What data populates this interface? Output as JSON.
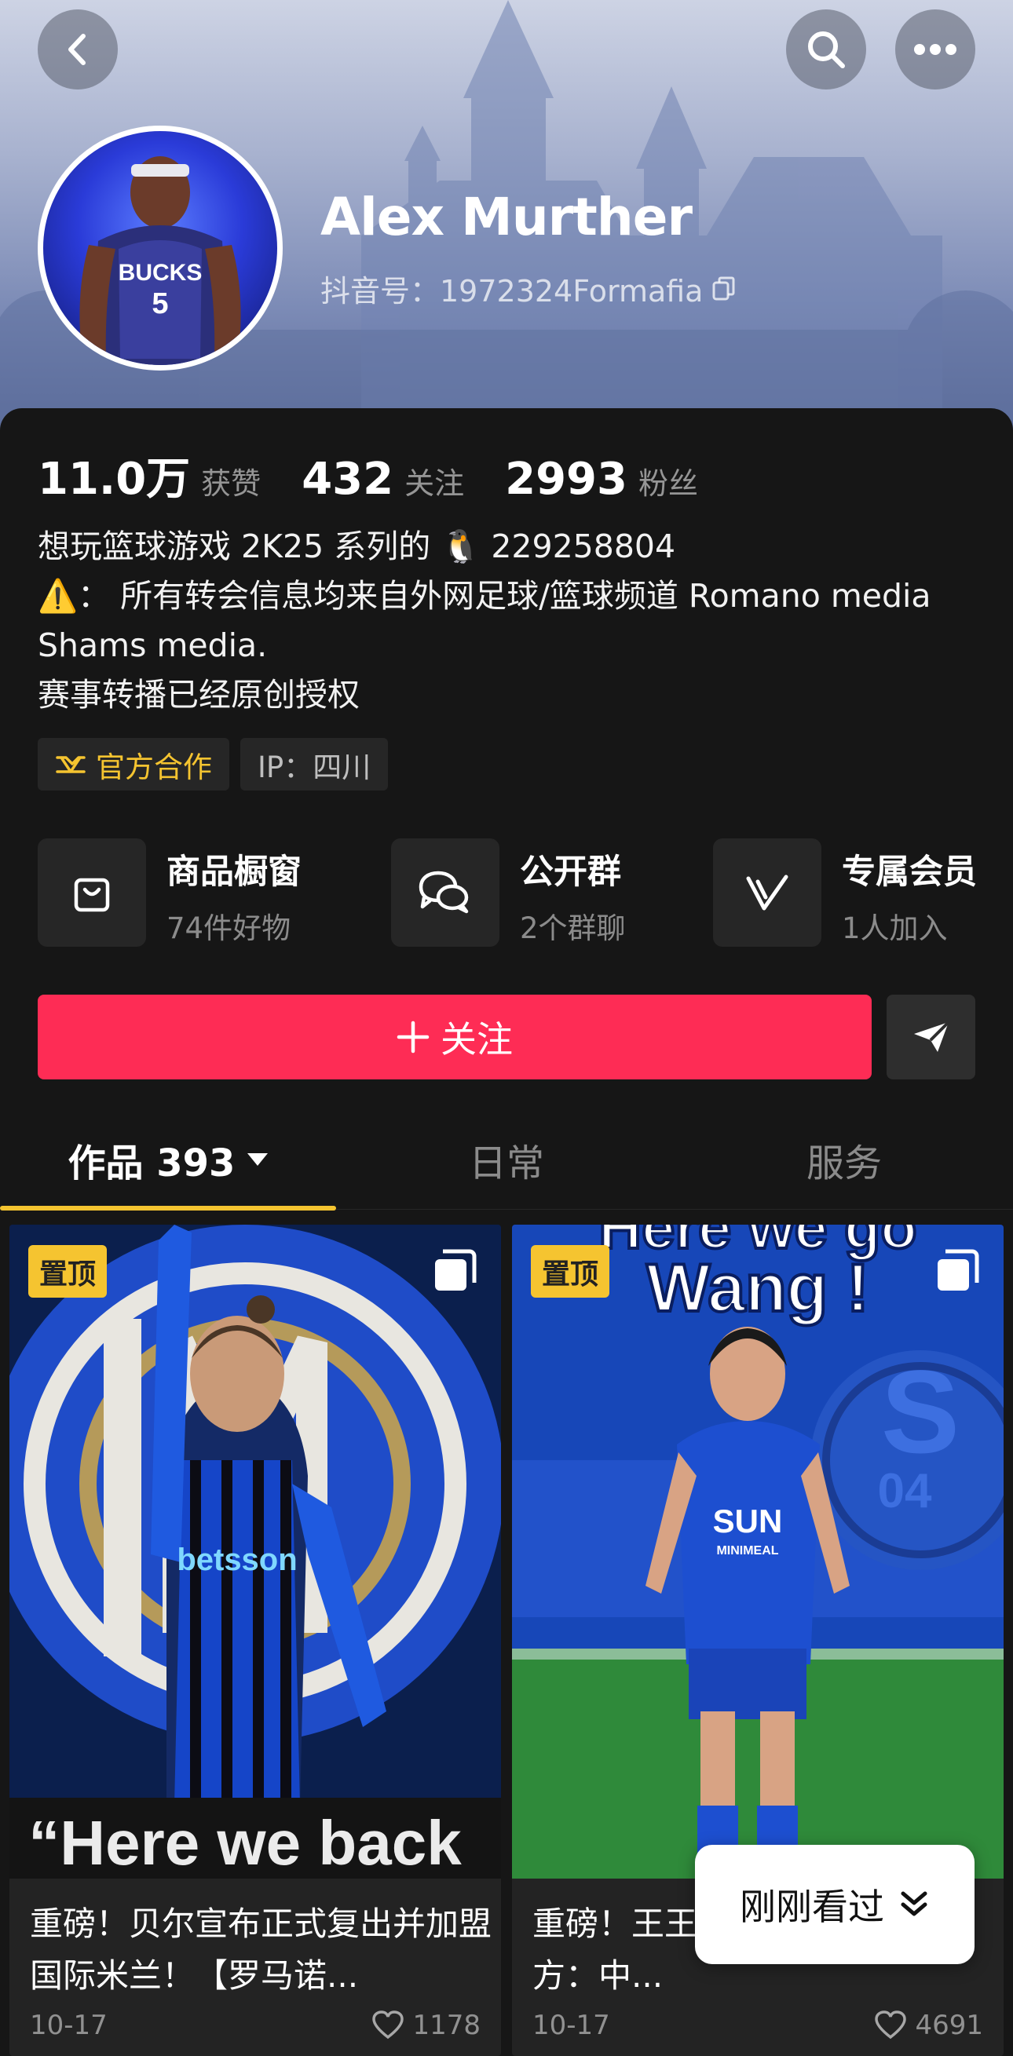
{
  "header": {
    "back_icon": "chevron-left-icon",
    "search_icon": "search-icon",
    "more_icon": "more-horizontal-icon"
  },
  "profile": {
    "name": "Alex Murther",
    "douyin_id": "抖音号：1972324Formafia",
    "avatar_jersey_text": "BUCKS",
    "avatar_jersey_number": "5"
  },
  "stats": [
    {
      "value": "11.0万",
      "label": "获赞"
    },
    {
      "value": "432",
      "label": "关注"
    },
    {
      "value": "2993",
      "label": "粉丝"
    }
  ],
  "bio": {
    "line1": "想玩篮球游戏 2K25 系列的 🐧 229258804",
    "line2": "⚠️： 所有转会信息均来自外网足球/篮球频道 Romano media Shams media.",
    "line3": " 赛事转播已经原创授权"
  },
  "tags": {
    "official": "官方合作",
    "ip": "IP：四川"
  },
  "features": [
    {
      "title": "商品橱窗",
      "sub": "74件好物",
      "icon": "shopping-bag-icon"
    },
    {
      "title": "公开群",
      "sub": "2个群聊",
      "icon": "chat-group-icon"
    },
    {
      "title": "专属会员",
      "sub": "1人加入",
      "icon": "vip-check-icon"
    }
  ],
  "actions": {
    "follow": "关注",
    "share_icon": "paper-plane-icon"
  },
  "tabs": [
    {
      "label": "作品 393",
      "active": true
    },
    {
      "label": "日常"
    },
    {
      "label": "服务"
    }
  ],
  "videos": [
    {
      "badge": "置顶",
      "thumb_caption": "“Here we back",
      "jersey_text": "betsson",
      "title": "重磅！贝尔宣布正式复出并加盟国际米兰！【罗马诺...",
      "date": "10-17",
      "likes": "1178"
    },
    {
      "badge": "置顶",
      "thumb_headline_1": "Here we go",
      "thumb_headline_2": "Wang !",
      "jersey_text": "SUN",
      "jersey_sub": "MINIMEAL",
      "crest_text": "04",
      "title": "重磅！王王 04 登陆德甲！官方：中...",
      "date": "10-17",
      "likes": "4691"
    }
  ],
  "recent_pill": "刚刚看过",
  "colors": {
    "accent": "#fe2c55",
    "gold": "#f5c430",
    "background": "#161616"
  }
}
